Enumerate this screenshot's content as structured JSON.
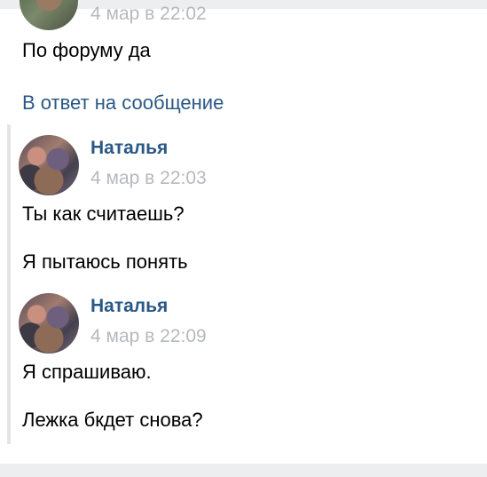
{
  "thread": {
    "top_partial_time": "4 мар в 22:02",
    "top_message": "По форуму да",
    "reply_link": "В ответ на сообщение",
    "posts": [
      {
        "author": "Наталья",
        "time": "4 мар в 22:03",
        "messages": [
          "Ты как считаешь?",
          "Я пытаюсь понять"
        ]
      },
      {
        "author": "Наталья",
        "time": "4 мар в 22:09",
        "messages": [
          "Я спрашиваю.",
          "Лежка бкдет снова?"
        ]
      }
    ]
  },
  "colors": {
    "link": "#2a5885",
    "muted": "#b5b9bf",
    "page_background": "#edeef0"
  }
}
